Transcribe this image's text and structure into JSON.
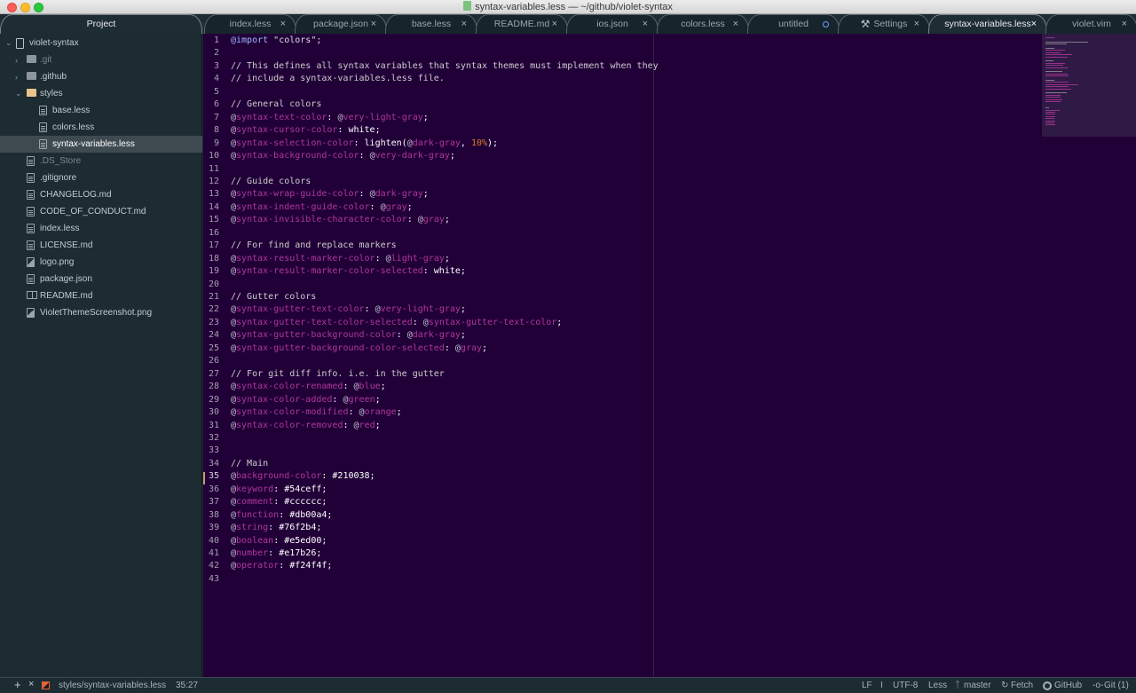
{
  "window": {
    "title": "syntax-variables.less — ~/github/violet-syntax"
  },
  "project_tab": {
    "label": "Project"
  },
  "tabs": [
    {
      "label": "index.less",
      "state": "close"
    },
    {
      "label": "package.json",
      "state": "close"
    },
    {
      "label": "base.less",
      "state": "close"
    },
    {
      "label": "README.md",
      "state": "close"
    },
    {
      "label": "ios.json",
      "state": "close"
    },
    {
      "label": "colors.less",
      "state": "close"
    },
    {
      "label": "untitled",
      "state": "modified"
    },
    {
      "label": "Settings",
      "state": "close",
      "icon": "tools-icon"
    },
    {
      "label": "syntax-variables.less",
      "state": "close",
      "active": true
    },
    {
      "label": "violet.vim",
      "state": "close"
    }
  ],
  "tree": {
    "root": "violet-syntax",
    "items": [
      {
        "name": ".git",
        "type": "folder",
        "expanded": false,
        "depth": 1,
        "dim": true
      },
      {
        "name": ".github",
        "type": "folder",
        "expanded": false,
        "depth": 1
      },
      {
        "name": "styles",
        "type": "folder",
        "expanded": true,
        "depth": 1
      },
      {
        "name": "base.less",
        "type": "file",
        "depth": 2
      },
      {
        "name": "colors.less",
        "type": "file",
        "depth": 2
      },
      {
        "name": "syntax-variables.less",
        "type": "file",
        "depth": 2,
        "selected": true
      },
      {
        "name": ".DS_Store",
        "type": "file",
        "depth": 1,
        "dim": true
      },
      {
        "name": ".gitignore",
        "type": "file",
        "depth": 1
      },
      {
        "name": "CHANGELOG.md",
        "type": "file",
        "depth": 1
      },
      {
        "name": "CODE_OF_CONDUCT.md",
        "type": "file",
        "depth": 1
      },
      {
        "name": "index.less",
        "type": "file",
        "depth": 1
      },
      {
        "name": "LICENSE.md",
        "type": "file",
        "depth": 1
      },
      {
        "name": "logo.png",
        "type": "image",
        "depth": 1
      },
      {
        "name": "package.json",
        "type": "file",
        "depth": 1
      },
      {
        "name": "README.md",
        "type": "book",
        "depth": 1
      },
      {
        "name": "VioletThemeScreenshot.png",
        "type": "image",
        "depth": 1
      }
    ]
  },
  "editor": {
    "lines": [
      [
        [
          "kw",
          "@import"
        ],
        [
          "str",
          " \"colors\";"
        ]
      ],
      [],
      [
        [
          "com",
          "// This defines all syntax variables that syntax themes must implement when they"
        ]
      ],
      [
        [
          "com",
          "// include a syntax-variables.less file."
        ]
      ],
      [],
      [
        [
          "com",
          "// General colors"
        ]
      ],
      [
        [
          "at",
          "@"
        ],
        [
          "var",
          "syntax-text-color"
        ],
        [
          "val",
          ": "
        ],
        [
          "at",
          "@"
        ],
        [
          "var",
          "very-light-gray"
        ],
        [
          "val",
          ";"
        ]
      ],
      [
        [
          "at",
          "@"
        ],
        [
          "var",
          "syntax-cursor-color"
        ],
        [
          "val",
          ": white;"
        ]
      ],
      [
        [
          "at",
          "@"
        ],
        [
          "var",
          "syntax-selection-color"
        ],
        [
          "val",
          ": lighten("
        ],
        [
          "at",
          "@"
        ],
        [
          "var",
          "dark-gray"
        ],
        [
          "val",
          ", "
        ],
        [
          "num",
          "10%"
        ],
        [
          "val",
          ");"
        ]
      ],
      [
        [
          "at",
          "@"
        ],
        [
          "var",
          "syntax-background-color"
        ],
        [
          "val",
          ": "
        ],
        [
          "at",
          "@"
        ],
        [
          "var",
          "very-dark-gray"
        ],
        [
          "val",
          ";"
        ]
      ],
      [],
      [
        [
          "com",
          "// Guide colors"
        ]
      ],
      [
        [
          "at",
          "@"
        ],
        [
          "var",
          "syntax-wrap-guide-color"
        ],
        [
          "val",
          ": "
        ],
        [
          "at",
          "@"
        ],
        [
          "var",
          "dark-gray"
        ],
        [
          "val",
          ";"
        ]
      ],
      [
        [
          "at",
          "@"
        ],
        [
          "var",
          "syntax-indent-guide-color"
        ],
        [
          "val",
          ": "
        ],
        [
          "at",
          "@"
        ],
        [
          "var",
          "gray"
        ],
        [
          "val",
          ";"
        ]
      ],
      [
        [
          "at",
          "@"
        ],
        [
          "var",
          "syntax-invisible-character-color"
        ],
        [
          "val",
          ": "
        ],
        [
          "at",
          "@"
        ],
        [
          "var",
          "gray"
        ],
        [
          "val",
          ";"
        ]
      ],
      [],
      [
        [
          "com",
          "// For find and replace markers"
        ]
      ],
      [
        [
          "at",
          "@"
        ],
        [
          "var",
          "syntax-result-marker-color"
        ],
        [
          "val",
          ": "
        ],
        [
          "at",
          "@"
        ],
        [
          "var",
          "light-gray"
        ],
        [
          "val",
          ";"
        ]
      ],
      [
        [
          "at",
          "@"
        ],
        [
          "var",
          "syntax-result-marker-color-selected"
        ],
        [
          "val",
          ": white;"
        ]
      ],
      [],
      [
        [
          "com",
          "// Gutter colors"
        ]
      ],
      [
        [
          "at",
          "@"
        ],
        [
          "var",
          "syntax-gutter-text-color"
        ],
        [
          "val",
          ": "
        ],
        [
          "at",
          "@"
        ],
        [
          "var",
          "very-light-gray"
        ],
        [
          "val",
          ";"
        ]
      ],
      [
        [
          "at",
          "@"
        ],
        [
          "var",
          "syntax-gutter-text-color-selected"
        ],
        [
          "val",
          ": "
        ],
        [
          "at",
          "@"
        ],
        [
          "var",
          "syntax-gutter-text-color"
        ],
        [
          "val",
          ";"
        ]
      ],
      [
        [
          "at",
          "@"
        ],
        [
          "var",
          "syntax-gutter-background-color"
        ],
        [
          "val",
          ": "
        ],
        [
          "at",
          "@"
        ],
        [
          "var",
          "dark-gray"
        ],
        [
          "val",
          ";"
        ]
      ],
      [
        [
          "at",
          "@"
        ],
        [
          "var",
          "syntax-gutter-background-color-selected"
        ],
        [
          "val",
          ": "
        ],
        [
          "at",
          "@"
        ],
        [
          "var",
          "gray"
        ],
        [
          "val",
          ";"
        ]
      ],
      [],
      [
        [
          "com",
          "// For git diff info. i.e. in the gutter"
        ]
      ],
      [
        [
          "at",
          "@"
        ],
        [
          "var",
          "syntax-color-renamed"
        ],
        [
          "val",
          ": "
        ],
        [
          "at",
          "@"
        ],
        [
          "var",
          "blue"
        ],
        [
          "val",
          ";"
        ]
      ],
      [
        [
          "at",
          "@"
        ],
        [
          "var",
          "syntax-color-added"
        ],
        [
          "val",
          ": "
        ],
        [
          "at",
          "@"
        ],
        [
          "var",
          "green"
        ],
        [
          "val",
          ";"
        ]
      ],
      [
        [
          "at",
          "@"
        ],
        [
          "var",
          "syntax-color-modified"
        ],
        [
          "val",
          ": "
        ],
        [
          "at",
          "@"
        ],
        [
          "var",
          "orange"
        ],
        [
          "val",
          ";"
        ]
      ],
      [
        [
          "at",
          "@"
        ],
        [
          "var",
          "syntax-color-removed"
        ],
        [
          "val",
          ": "
        ],
        [
          "at",
          "@"
        ],
        [
          "var",
          "red"
        ],
        [
          "val",
          ";"
        ]
      ],
      [],
      [],
      [
        [
          "com",
          "// Main"
        ]
      ],
      [
        [
          "at",
          "@"
        ],
        [
          "var",
          "background-color"
        ],
        [
          "val",
          ": #210038;"
        ]
      ],
      [
        [
          "at",
          "@"
        ],
        [
          "var",
          "keyword"
        ],
        [
          "val",
          ": #54ceff;"
        ]
      ],
      [
        [
          "at",
          "@"
        ],
        [
          "var",
          "comment"
        ],
        [
          "val",
          ": #cccccc;"
        ]
      ],
      [
        [
          "at",
          "@"
        ],
        [
          "var",
          "function"
        ],
        [
          "val",
          ": #db00a4;"
        ]
      ],
      [
        [
          "at",
          "@"
        ],
        [
          "var",
          "string"
        ],
        [
          "val",
          ": #76f2b4;"
        ]
      ],
      [
        [
          "at",
          "@"
        ],
        [
          "var",
          "boolean"
        ],
        [
          "val",
          ": #e5ed00;"
        ]
      ],
      [
        [
          "at",
          "@"
        ],
        [
          "var",
          "number"
        ],
        [
          "val",
          ": #e17b26;"
        ]
      ],
      [
        [
          "at",
          "@"
        ],
        [
          "var",
          "operator"
        ],
        [
          "val",
          ": #f24f4f;"
        ]
      ],
      []
    ],
    "cursor_line": 35,
    "background": "#210038"
  },
  "statusbar": {
    "add_label": "+",
    "close_label": "×",
    "file_path": "styles/syntax-variables.less",
    "cursor_position": "35:27",
    "line_ending": "LF",
    "separator": "I",
    "encoding": "UTF-8",
    "grammar": "Less",
    "branch": "master",
    "fetch": "Fetch",
    "github": "GitHub",
    "git": "Git (1)"
  }
}
